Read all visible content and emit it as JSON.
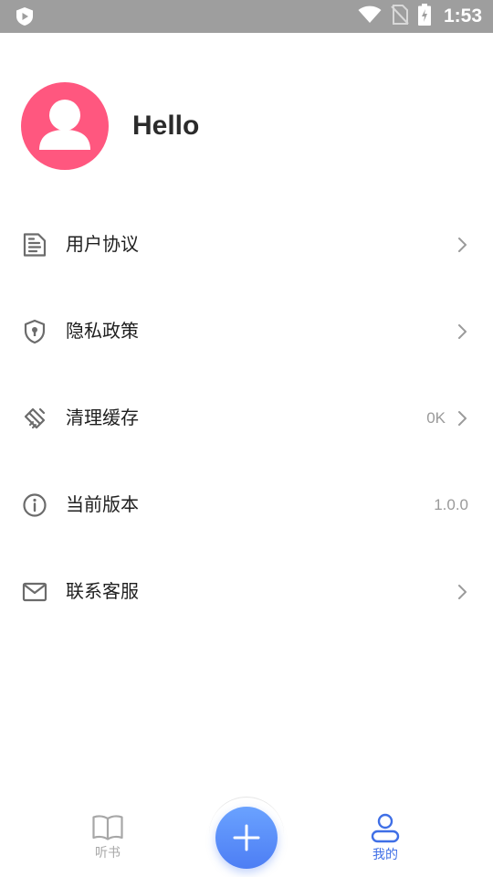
{
  "status_bar": {
    "time": "1:53",
    "icons": [
      "app-shield-icon",
      "wifi-icon",
      "no-sim-icon",
      "battery-charging-icon"
    ]
  },
  "profile": {
    "name": "Hello",
    "avatar_icon": "user-avatar-icon",
    "avatar_color": "#ff577f"
  },
  "menu": {
    "items": [
      {
        "label": "用户协议",
        "icon": "document-icon",
        "value": "",
        "chevron": true
      },
      {
        "label": "隐私政策",
        "icon": "shield-lock-icon",
        "value": "",
        "chevron": true
      },
      {
        "label": "清理缓存",
        "icon": "broom-icon",
        "value": "0K",
        "chevron": true
      },
      {
        "label": "当前版本",
        "icon": "info-icon",
        "value": "1.0.0",
        "chevron": false
      },
      {
        "label": "联系客服",
        "icon": "mail-icon",
        "value": "",
        "chevron": true
      }
    ]
  },
  "bottom_nav": {
    "items": [
      {
        "label": "听书",
        "icon": "book-icon",
        "active": false
      },
      {
        "label": "",
        "icon": "plus-icon",
        "active": false
      },
      {
        "label": "我的",
        "icon": "person-icon",
        "active": true
      }
    ],
    "active_color": "#3f6fe6",
    "inactive_color": "#a7a7a7"
  }
}
